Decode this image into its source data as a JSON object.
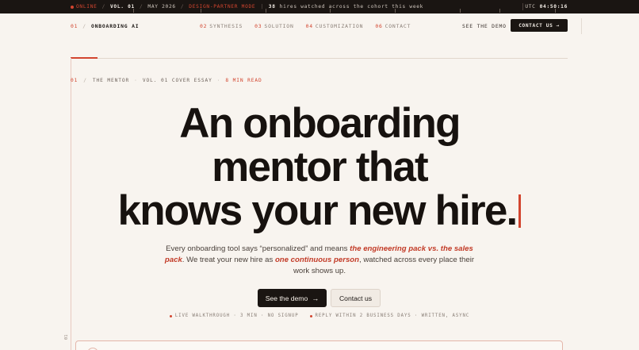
{
  "ticker": {
    "status": "ONLINE",
    "volume": "VOL. 01",
    "date": "MAY 2026",
    "mode": "DESIGN-PARTNER MODE",
    "hires_count": "38",
    "hires_text": "hires watched across the cohort this week",
    "utc_label": "UTC",
    "utc_time": "04:50:16"
  },
  "nav": {
    "brand_num": "01",
    "brand_name": "ONBOARDING AI",
    "links": [
      {
        "num": "02",
        "label": "SYNTHESIS"
      },
      {
        "num": "03",
        "label": "SOLUTION"
      },
      {
        "num": "04",
        "label": "CUSTOMIZATION"
      },
      {
        "num": "06",
        "label": "CONTACT"
      }
    ],
    "demo_link": "SEE THE DEMO",
    "contact_button": "CONTACT US",
    "contact_arrow": "→"
  },
  "eyebrow": {
    "num": "01",
    "section": "THE MENTOR",
    "issue": "VOL. 01 COVER ESSAY",
    "read_time": "8 MIN READ"
  },
  "hero": {
    "line1": "An onboarding",
    "line2": "mentor that",
    "line3": "knows your new hire.",
    "lede_part1": "Every onboarding tool says “personalized” and means ",
    "lede_em1": "the engineering pack vs. the sales pack",
    "lede_part2": ". We treat your new hire as ",
    "lede_em2": "one continuous person",
    "lede_part3": ", watched across every place their work shows up."
  },
  "cta": {
    "primary": "See the demo",
    "primary_arrow": "→",
    "secondary": "Contact us"
  },
  "meta": {
    "item1": "LIVE WALKTHROUGH · 3 MIN · NO SIGNUP",
    "item2": "REPLY WITHIN 2 BUSINESS DAYS · WRITTEN, ASYNC"
  },
  "side_num": "01",
  "colors": {
    "accent": "#d2452f",
    "background": "#f8f4ef",
    "ink": "#1a1512"
  }
}
